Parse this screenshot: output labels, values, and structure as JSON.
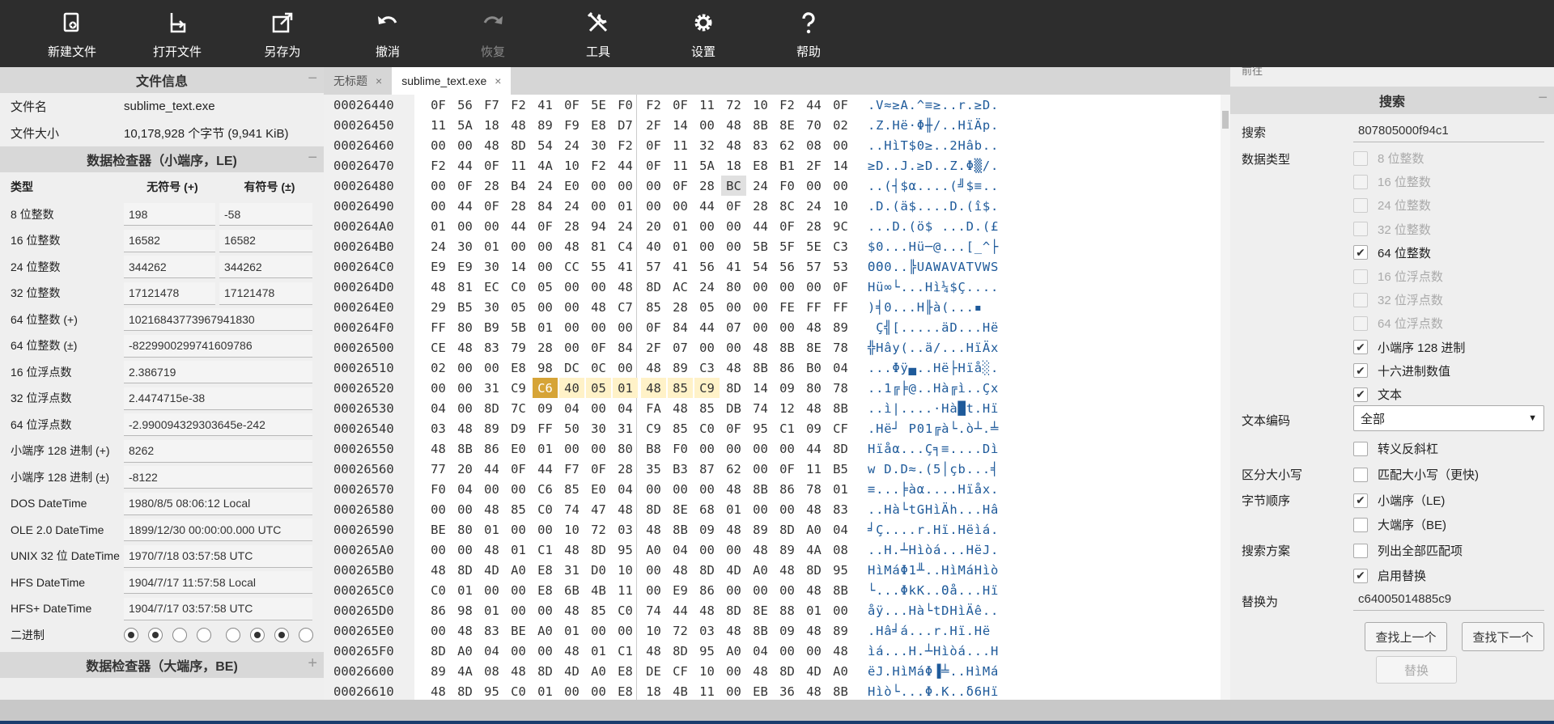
{
  "toolbar": [
    {
      "label": "新建文件",
      "icon": "new-file-icon",
      "enabled": true
    },
    {
      "label": "打开文件",
      "icon": "open-file-icon",
      "enabled": true
    },
    {
      "label": "另存为",
      "icon": "save-as-icon",
      "enabled": true
    },
    {
      "label": "撤消",
      "icon": "undo-icon",
      "enabled": true
    },
    {
      "label": "恢复",
      "icon": "redo-icon",
      "enabled": false
    },
    {
      "label": "工具",
      "icon": "tools-icon",
      "enabled": true
    },
    {
      "label": "设置",
      "icon": "gear-icon",
      "enabled": true
    },
    {
      "label": "帮助",
      "icon": "help-icon",
      "enabled": true
    }
  ],
  "file_info": {
    "title": "文件信息",
    "collapse": "−",
    "name_label": "文件名",
    "name_value": "sublime_text.exe",
    "size_label": "文件大小",
    "size_value": "10,178,928 个字节 (9,941 KiB)"
  },
  "inspector_le": {
    "title": "数据检查器（小端序，LE)",
    "collapse": "−",
    "col_type": "类型",
    "col_unsigned": "无符号 (+)",
    "col_signed": "有符号 (±)",
    "rows": [
      {
        "label": "8 位整数",
        "u": "198",
        "s": "-58"
      },
      {
        "label": "16 位整数",
        "u": "16582",
        "s": "16582"
      },
      {
        "label": "24 位整数",
        "u": "344262",
        "s": "344262"
      },
      {
        "label": "32 位整数",
        "u": "17121478",
        "s": "17121478"
      }
    ],
    "wide_rows": [
      {
        "label": "64 位整数 (+)",
        "v": "10216843773967941830"
      },
      {
        "label": "64 位整数 (±)",
        "v": "-8229900299741609786"
      },
      {
        "label": "16 位浮点数",
        "v": "2.386719"
      },
      {
        "label": "32 位浮点数",
        "v": "2.4474715e-38"
      },
      {
        "label": "64 位浮点数",
        "v": "-2.990094329303645e-242"
      },
      {
        "label": "小端序 128 进制 (+)",
        "v": "8262"
      },
      {
        "label": "小端序 128 进制 (±)",
        "v": "-8122"
      },
      {
        "label": "DOS DateTime",
        "v": "1980/8/5 08:06:12 Local"
      },
      {
        "label": "OLE 2.0 DateTime",
        "v": "1899/12/30 00:00:00.000 UTC"
      },
      {
        "label": "UNIX 32 位 DateTime",
        "v": "1970/7/18 03:57:58 UTC"
      },
      {
        "label": "HFS DateTime",
        "v": "1904/7/17 11:57:58 Local"
      },
      {
        "label": "HFS+ DateTime",
        "v": "1904/7/17 03:57:58 UTC"
      }
    ],
    "binary_label": "二进制",
    "binary_bits": [
      1,
      1,
      0,
      0,
      0,
      1,
      1,
      0
    ]
  },
  "inspector_be": {
    "title": "数据检查器（大端序，BE)",
    "expand": "+"
  },
  "tabs": [
    {
      "label": "无标题",
      "close": "×",
      "active": false
    },
    {
      "label": "sublime_text.exe",
      "close": "×",
      "active": true
    }
  ],
  "hex_rows": [
    {
      "addr": "00026440",
      "bytes": [
        "0F",
        "56",
        "F7",
        "F2",
        "41",
        "0F",
        "5E",
        "F0",
        "F2",
        "0F",
        "11",
        "72",
        "10",
        "F2",
        "44",
        "0F"
      ],
      "text": ".V≈≥A.^≡≥..r.≥D."
    },
    {
      "addr": "00026450",
      "bytes": [
        "11",
        "5A",
        "18",
        "48",
        "89",
        "F9",
        "E8",
        "D7",
        "2F",
        "14",
        "00",
        "48",
        "8B",
        "8E",
        "70",
        "02"
      ],
      "text": ".Z.Hë·Φ╫/..HïÄp."
    },
    {
      "addr": "00026460",
      "bytes": [
        "00",
        "00",
        "48",
        "8D",
        "54",
        "24",
        "30",
        "F2",
        "0F",
        "11",
        "32",
        "48",
        "83",
        "62",
        "08",
        "00"
      ],
      "text": "..HìT$0≥..2Hâb.."
    },
    {
      "addr": "00026470",
      "bytes": [
        "F2",
        "44",
        "0F",
        "11",
        "4A",
        "10",
        "F2",
        "44",
        "0F",
        "11",
        "5A",
        "18",
        "E8",
        "B1",
        "2F",
        "14"
      ],
      "text": "≥D..J.≥D..Z.Φ▒/."
    },
    {
      "addr": "00026480",
      "bytes": [
        "00",
        "0F",
        "28",
        "B4",
        "24",
        "E0",
        "00",
        "00",
        "00",
        "0F",
        "28",
        "BC",
        "24",
        "F0",
        "00",
        "00"
      ],
      "text": "..(┤$α....(╝$≡.."
    },
    {
      "addr": "00026490",
      "bytes": [
        "00",
        "44",
        "0F",
        "28",
        "84",
        "24",
        "00",
        "01",
        "00",
        "00",
        "44",
        "0F",
        "28",
        "8C",
        "24",
        "10"
      ],
      "text": ".D.(ä$....D.(î$."
    },
    {
      "addr": "000264A0",
      "bytes": [
        "01",
        "00",
        "00",
        "44",
        "0F",
        "28",
        "94",
        "24",
        "20",
        "01",
        "00",
        "00",
        "44",
        "0F",
        "28",
        "9C"
      ],
      "text": "...D.(ö$ ...D.(£"
    },
    {
      "addr": "000264B0",
      "bytes": [
        "24",
        "30",
        "01",
        "00",
        "00",
        "48",
        "81",
        "C4",
        "40",
        "01",
        "00",
        "00",
        "5B",
        "5F",
        "5E",
        "C3"
      ],
      "text": "$0...Hü─@...[_^├"
    },
    {
      "addr": "000264C0",
      "bytes": [
        "E9",
        "E9",
        "30",
        "14",
        "00",
        "CC",
        "55",
        "41",
        "57",
        "41",
        "56",
        "41",
        "54",
        "56",
        "57",
        "53"
      ],
      "text": "ΘΘ0..╠UAWAVATVWS"
    },
    {
      "addr": "000264D0",
      "bytes": [
        "48",
        "81",
        "EC",
        "C0",
        "05",
        "00",
        "00",
        "48",
        "8D",
        "AC",
        "24",
        "80",
        "00",
        "00",
        "00",
        "0F"
      ],
      "text": "Hü∞└...Hì¼$Ç...."
    },
    {
      "addr": "000264E0",
      "bytes": [
        "29",
        "B5",
        "30",
        "05",
        "00",
        "00",
        "48",
        "C7",
        "85",
        "28",
        "05",
        "00",
        "00",
        "FE",
        "FF",
        "FF"
      ],
      "text": ")╡0...H╟à(...▪  "
    },
    {
      "addr": "000264F0",
      "bytes": [
        "FF",
        "80",
        "B9",
        "5B",
        "01",
        "00",
        "00",
        "00",
        "0F",
        "84",
        "44",
        "07",
        "00",
        "00",
        "48",
        "89"
      ],
      "text": " Ç╣[.....äD...Hë"
    },
    {
      "addr": "00026500",
      "bytes": [
        "CE",
        "48",
        "83",
        "79",
        "28",
        "00",
        "0F",
        "84",
        "2F",
        "07",
        "00",
        "00",
        "48",
        "8B",
        "8E",
        "78"
      ],
      "text": "╬Hây(..ä/...HïÄx"
    },
    {
      "addr": "00026510",
      "bytes": [
        "02",
        "00",
        "00",
        "E8",
        "98",
        "DC",
        "0C",
        "00",
        "48",
        "89",
        "C3",
        "48",
        "8B",
        "86",
        "B0",
        "04"
      ],
      "text": "...Φÿ▄..Hë├Hïå░."
    },
    {
      "addr": "00026520",
      "bytes": [
        "00",
        "00",
        "31",
        "C9",
        "C6",
        "40",
        "05",
        "01",
        "48",
        "85",
        "C9",
        "8D",
        "14",
        "09",
        "80",
        "78"
      ],
      "text": "..1╔╞@..Hà╔ì..Çx"
    },
    {
      "addr": "00026530",
      "bytes": [
        "04",
        "00",
        "8D",
        "7C",
        "09",
        "04",
        "00",
        "04",
        "FA",
        "48",
        "85",
        "DB",
        "74",
        "12",
        "48",
        "8B"
      ],
      "text": "..ì|....·Hà█t.Hï"
    },
    {
      "addr": "00026540",
      "bytes": [
        "03",
        "48",
        "89",
        "D9",
        "FF",
        "50",
        "30",
        "31",
        "C9",
        "85",
        "C0",
        "0F",
        "95",
        "C1",
        "09",
        "CF"
      ],
      "text": ".Hë┘ P01╔à└.ò┴.╧"
    },
    {
      "addr": "00026550",
      "bytes": [
        "48",
        "8B",
        "86",
        "E0",
        "01",
        "00",
        "00",
        "80",
        "B8",
        "F0",
        "00",
        "00",
        "00",
        "00",
        "44",
        "8D"
      ],
      "text": "Hïåα...Ç╕≡....Dì"
    },
    {
      "addr": "00026560",
      "bytes": [
        "77",
        "20",
        "44",
        "0F",
        "44",
        "F7",
        "0F",
        "28",
        "35",
        "B3",
        "87",
        "62",
        "00",
        "0F",
        "11",
        "B5"
      ],
      "text": "w D.D≈.(5│çb...╡"
    },
    {
      "addr": "00026570",
      "bytes": [
        "F0",
        "04",
        "00",
        "00",
        "C6",
        "85",
        "E0",
        "04",
        "00",
        "00",
        "00",
        "48",
        "8B",
        "86",
        "78",
        "01"
      ],
      "text": "≡...╞àα....Hïåx."
    },
    {
      "addr": "00026580",
      "bytes": [
        "00",
        "00",
        "48",
        "85",
        "C0",
        "74",
        "47",
        "48",
        "8D",
        "8E",
        "68",
        "01",
        "00",
        "00",
        "48",
        "83"
      ],
      "text": "..Hà└tGHìÄh...Hâ"
    },
    {
      "addr": "00026590",
      "bytes": [
        "BE",
        "80",
        "01",
        "00",
        "00",
        "10",
        "72",
        "03",
        "48",
        "8B",
        "09",
        "48",
        "89",
        "8D",
        "A0",
        "04"
      ],
      "text": "╛Ç....r.Hï.Hëìá."
    },
    {
      "addr": "000265A0",
      "bytes": [
        "00",
        "00",
        "48",
        "01",
        "C1",
        "48",
        "8D",
        "95",
        "A0",
        "04",
        "00",
        "00",
        "48",
        "89",
        "4A",
        "08"
      ],
      "text": "..H.┴Hìòá...HëJ."
    },
    {
      "addr": "000265B0",
      "bytes": [
        "48",
        "8D",
        "4D",
        "A0",
        "E8",
        "31",
        "D0",
        "10",
        "00",
        "48",
        "8D",
        "4D",
        "A0",
        "48",
        "8D",
        "95"
      ],
      "text": "HìMáΦ1╨..HìMáHìò"
    },
    {
      "addr": "000265C0",
      "bytes": [
        "C0",
        "01",
        "00",
        "00",
        "E8",
        "6B",
        "4B",
        "11",
        "00",
        "E9",
        "86",
        "00",
        "00",
        "00",
        "48",
        "8B"
      ],
      "text": "└...ΦkK..Θå...Hï"
    },
    {
      "addr": "000265D0",
      "bytes": [
        "86",
        "98",
        "01",
        "00",
        "00",
        "48",
        "85",
        "C0",
        "74",
        "44",
        "48",
        "8D",
        "8E",
        "88",
        "01",
        "00"
      ],
      "text": "åÿ...Hà└tDHìÄê.."
    },
    {
      "addr": "000265E0",
      "bytes": [
        "00",
        "48",
        "83",
        "BE",
        "A0",
        "01",
        "00",
        "00",
        "10",
        "72",
        "03",
        "48",
        "8B",
        "09",
        "48",
        "89"
      ],
      "text": ".Hâ╛á...r.Hï.Hë"
    },
    {
      "addr": "000265F0",
      "bytes": [
        "8D",
        "A0",
        "04",
        "00",
        "00",
        "48",
        "01",
        "C1",
        "48",
        "8D",
        "95",
        "A0",
        "04",
        "00",
        "00",
        "48"
      ],
      "text": "ìá...H.┴Hìòá...H"
    },
    {
      "addr": "00026600",
      "bytes": [
        "89",
        "4A",
        "08",
        "48",
        "8D",
        "4D",
        "A0",
        "E8",
        "DE",
        "CF",
        "10",
        "00",
        "48",
        "8D",
        "4D",
        "A0"
      ],
      "text": "ëJ.HìMáΦ▐╧..HìMá"
    },
    {
      "addr": "00026610",
      "bytes": [
        "48",
        "8D",
        "95",
        "C0",
        "01",
        "00",
        "00",
        "E8",
        "18",
        "4B",
        "11",
        "00",
        "EB",
        "36",
        "48",
        "8B"
      ],
      "text": "Hìò└...Φ.K..δ6Hï"
    }
  ],
  "search": {
    "prev_label": "前往",
    "title": "搜索",
    "collapse": "−",
    "search_label": "搜索",
    "search_value": "807805000f94c1",
    "datatype_label": "数据类型",
    "types": [
      {
        "label": "8 位整数",
        "checked": false,
        "enabled": false
      },
      {
        "label": "16 位整数",
        "checked": false,
        "enabled": false
      },
      {
        "label": "24 位整数",
        "checked": false,
        "enabled": false
      },
      {
        "label": "32 位整数",
        "checked": false,
        "enabled": false
      },
      {
        "label": "64 位整数",
        "checked": true,
        "enabled": true
      },
      {
        "label": "16 位浮点数",
        "checked": false,
        "enabled": false
      },
      {
        "label": "32 位浮点数",
        "checked": false,
        "enabled": false
      },
      {
        "label": "64 位浮点数",
        "checked": false,
        "enabled": false
      },
      {
        "label": "小端序 128 进制",
        "checked": true,
        "enabled": true
      },
      {
        "label": "十六进制数值",
        "checked": true,
        "enabled": true
      },
      {
        "label": "文本",
        "checked": true,
        "enabled": true
      }
    ],
    "encoding_label": "文本编码",
    "encoding_value": "全部",
    "escape_label": "转义反斜杠",
    "case_label": "区分大小写",
    "case_option": "匹配大小写（更快)",
    "order_label": "字节顺序",
    "order_le": "小端序（LE)",
    "order_be": "大端序（BE)",
    "scheme_label": "搜索方案",
    "scheme_all": "列出全部匹配项",
    "scheme_replace": "启用替换",
    "replace_label": "替换为",
    "replace_value": "c64005014885c9",
    "find_prev": "查找上一个",
    "find_next": "查找下一个",
    "replace_btn": "替换",
    "check_mark": "✔"
  }
}
